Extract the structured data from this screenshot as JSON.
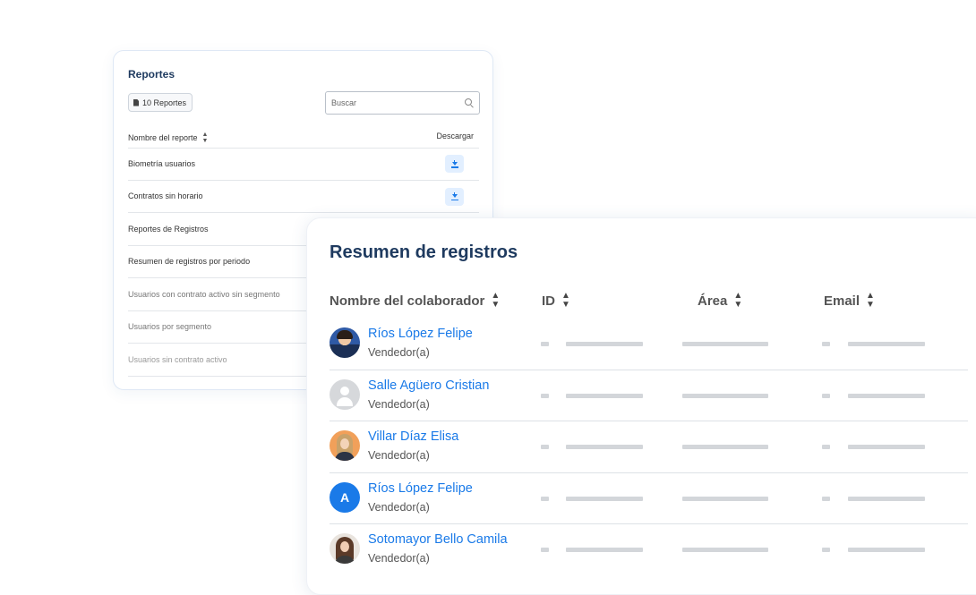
{
  "reports": {
    "title": "Reportes",
    "count_label": "10 Reportes",
    "search_placeholder": "Buscar",
    "col_name": "Nombre del reporte",
    "col_download": "Descargar",
    "rows": [
      {
        "label": "Biometría usuarios",
        "download": true
      },
      {
        "label": "Contratos sin horario",
        "download": true
      },
      {
        "label": "Reportes de Registros",
        "download": false
      },
      {
        "label": "Resumen de registros por periodo",
        "download": false
      },
      {
        "label": "Usuarios con contrato activo sin segmento",
        "download": false
      },
      {
        "label": "Usuarios por segmento",
        "download": false
      },
      {
        "label": "Usuarios sin contrato activo",
        "download": false
      }
    ]
  },
  "summary": {
    "title": "Resumen de registros",
    "columns": [
      "Nombre del colaborador",
      "ID",
      "Área",
      "Email"
    ],
    "rows": [
      {
        "name": "Ríos López Felipe",
        "role": "Vendedor(a)",
        "avatar": "photo-man"
      },
      {
        "name": "Salle Agüero Cristian",
        "role": "Vendedor(a)",
        "avatar": "generic-user-icon"
      },
      {
        "name": "Villar Díaz Elisa",
        "role": "Vendedor(a)",
        "avatar": "photo-woman-blonde"
      },
      {
        "name": "Ríos López Felipe",
        "role": "Vendedor(a)",
        "avatar": "A"
      },
      {
        "name": "Sotomayor Bello Camila",
        "role": "Vendedor(a)",
        "avatar": "photo-woman-brunette"
      }
    ]
  },
  "colors": {
    "title": "#1e3a5f",
    "accent": "#1a7ae8",
    "download_bg": "#e2efff",
    "placeholder": "#d3d6da"
  }
}
